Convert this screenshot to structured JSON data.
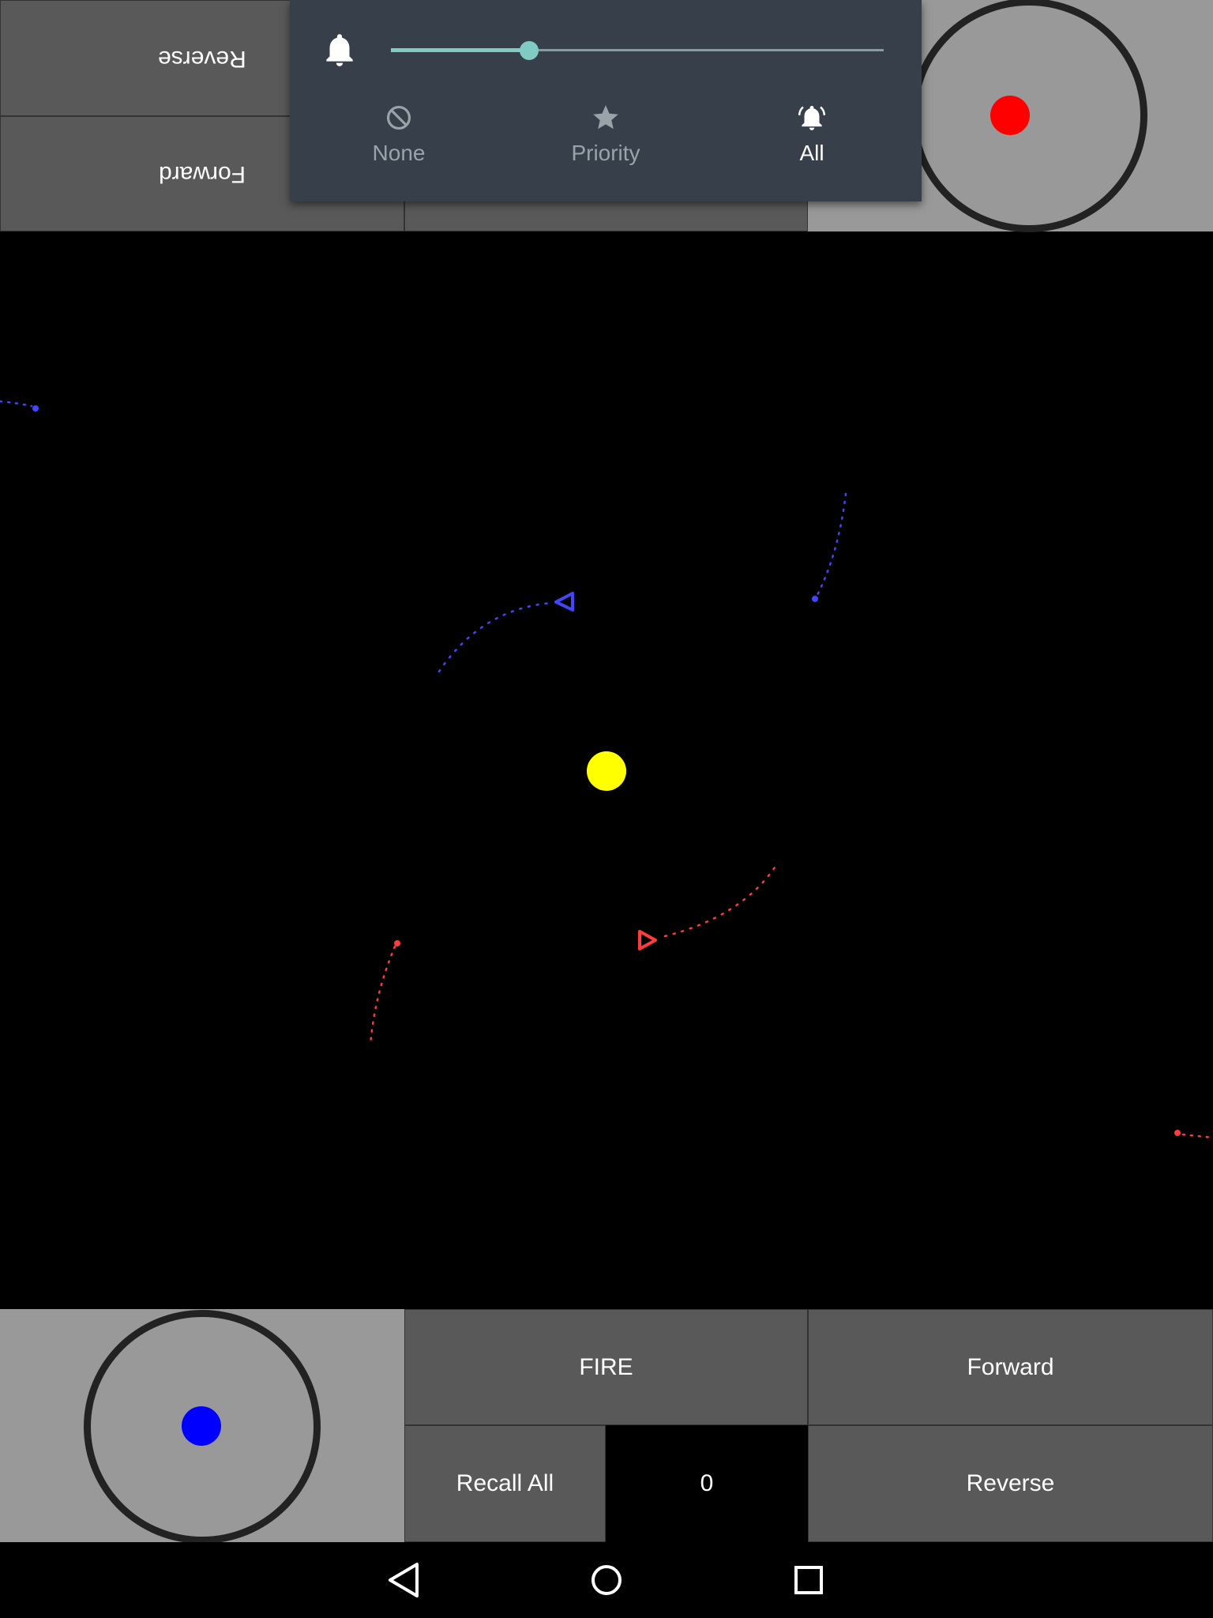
{
  "top_player": {
    "reverse_label": "Reverse",
    "forward_label": "Forward"
  },
  "notification_panel": {
    "volume_level": 0.28,
    "modes": [
      {
        "label": "None",
        "icon": "block-icon",
        "active": false
      },
      {
        "label": "Priority",
        "icon": "star-icon",
        "active": false
      },
      {
        "label": "All",
        "icon": "bell-ring-icon",
        "active": true
      }
    ]
  },
  "bottom_player": {
    "fire_label": "FIRE",
    "forward_label": "Forward",
    "recall_label": "Recall All",
    "score": "0",
    "reverse_label": "Reverse"
  },
  "colors": {
    "blue_player": "#0000ff",
    "red_player": "#ff0000",
    "sun": "#ffff00",
    "ship_blue": "#4444ff",
    "ship_red": "#ff3b3b",
    "panel_accent": "#80cbc4"
  },
  "nav": {
    "back": "back-icon",
    "home": "home-icon",
    "recents": "recents-icon"
  }
}
